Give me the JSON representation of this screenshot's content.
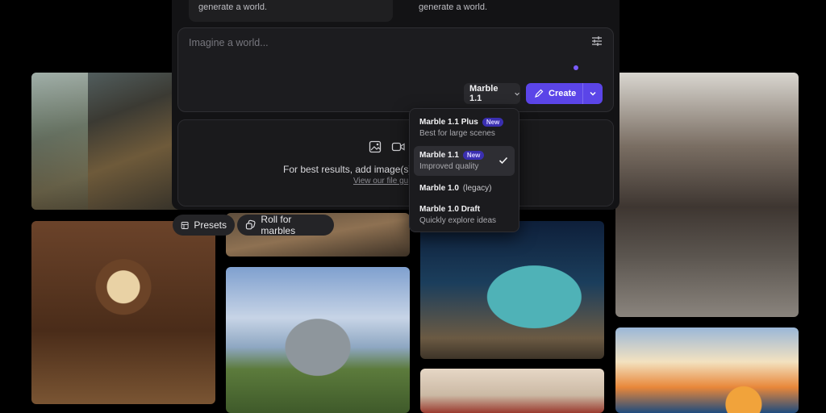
{
  "top_cards": [
    {
      "text": "generate a world."
    },
    {
      "text": "generate a world."
    }
  ],
  "composer": {
    "placeholder": "Imagine a world...",
    "model_label": "Marble 1.1",
    "create_label": "Create"
  },
  "upload": {
    "text": "For best results, add image(s),",
    "link": "View our file gu"
  },
  "chips": {
    "presets": "Presets",
    "roll": "Roll for marbles"
  },
  "dropdown": {
    "options": [
      {
        "name": "Marble 1.1 Plus",
        "badge": "New",
        "desc": "Best for large scenes"
      },
      {
        "name": "Marble 1.1",
        "badge": "New",
        "desc": "Improved quality",
        "selected": true
      },
      {
        "name": "Marble 1.0",
        "note": "(legacy)"
      },
      {
        "name": "Marble 1.0 Draft",
        "desc": "Quickly explore ideas"
      }
    ]
  },
  "colors": {
    "accent": "#5b45e8",
    "badge": "#3a2fb0",
    "panel": "#131315"
  },
  "icons": {
    "settings": "sliders-icon",
    "model_chevron": "chevron-down-icon",
    "create": "pencil-brush-icon",
    "create_more": "chevron-down-icon",
    "image": "image-icon",
    "video": "video-icon",
    "presets": "layout-icon",
    "roll": "dice-icon",
    "check": "check-icon"
  }
}
